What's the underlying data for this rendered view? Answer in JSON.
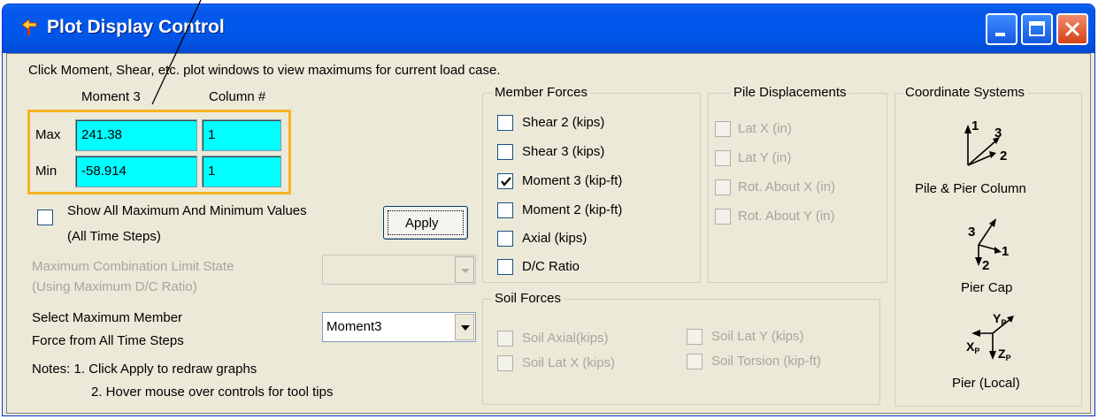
{
  "window": {
    "title": "Plot Display Control"
  },
  "instructions": "Click Moment, Shear, etc. plot windows to view maximums for current load case.",
  "values": {
    "col1_header": "Moment 3",
    "col2_header": "Column #",
    "max_label": "Max",
    "min_label": "Min",
    "max_value": "241.38",
    "max_column": "1",
    "min_value": "-58.914",
    "min_column": "1"
  },
  "show_all": {
    "label_line1": "Show All Maximum And Minimum Values",
    "label_line2": "(All Time Steps)",
    "checked": false
  },
  "apply_label": "Apply",
  "max_combination": {
    "label_line1": "Maximum Combination Limit State",
    "label_line2": "(Using Maximum D/C Ratio)",
    "value": ""
  },
  "select_max": {
    "label_line1": "Select Maximum Member",
    "label_line2": "Force from All Time Steps",
    "value": "Moment3"
  },
  "notes": {
    "line1": "Notes: 1. Click Apply to redraw graphs",
    "line2": "2. Hover mouse over controls for tool tips"
  },
  "member_forces": {
    "title": "Member Forces",
    "items": [
      {
        "label": "Shear 2 (kips)",
        "checked": false
      },
      {
        "label": "Shear 3 (kips)",
        "checked": false
      },
      {
        "label": "Moment 3 (kip-ft)",
        "checked": true
      },
      {
        "label": "Moment 2 (kip-ft)",
        "checked": false
      },
      {
        "label": "Axial (kips)",
        "checked": false
      },
      {
        "label": "D/C Ratio",
        "checked": false
      }
    ]
  },
  "pile_displacements": {
    "title": "Pile Displacements",
    "items": [
      {
        "label": "Lat X (in)"
      },
      {
        "label": "Lat Y (in)"
      },
      {
        "label": "Rot. About X (in)"
      },
      {
        "label": "Rot. About Y (in)"
      }
    ]
  },
  "soil_forces": {
    "title": "Soil Forces",
    "items": [
      {
        "label": "Soil Axial(kips)"
      },
      {
        "label": "Soil Lat X (kips)"
      },
      {
        "label": "Soil Lat Y (kips)"
      },
      {
        "label": "Soil Torsion (kip-ft)"
      }
    ]
  },
  "coordinate_systems": {
    "title": "Coordinate Systems",
    "pile_pier_column": {
      "label": "Pile & Pier Column",
      "axis1": "1",
      "axis2": "2",
      "axis3": "3"
    },
    "pier_cap": {
      "label": "Pier Cap",
      "axis1": "1",
      "axis2": "2",
      "axis3": "3"
    },
    "pier_local": {
      "label": "Pier (Local)",
      "axis_x": "X",
      "axis_y": "Y",
      "axis_z": "Z",
      "sub": "P"
    }
  },
  "colors": {
    "titlebar": "#0055e5",
    "field_bg": "#00ffff",
    "highlight": "#f5b324",
    "close_button": "#d6421b"
  }
}
